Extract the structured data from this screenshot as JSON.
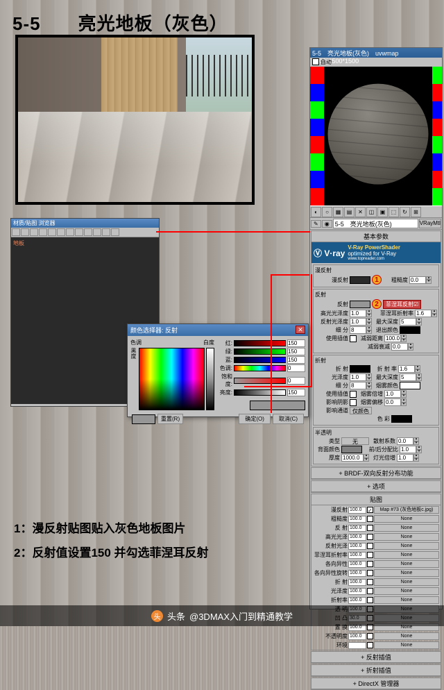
{
  "title": "5-5　　亮光地板（灰色）",
  "material_editor": {
    "window_title": "5-5　亮光地板(灰色)　uvwmap 1500*1500*1500",
    "auto": "自动",
    "name": "5-5　亮光地板(灰色)",
    "type": "VRayMtl",
    "rollout_basic": "基本参数",
    "vray_brand": "Ⓥ V·ray",
    "vray_shader": "V-Ray PowerShader",
    "vray_opt": "optimized for V-Ray",
    "vray_url": "www.topreader.com",
    "diffuse_section": "漫反射",
    "diffuse_label": "漫反射",
    "roughness_label": "粗糙度",
    "roughness_val": "0.0",
    "reflect_section": "反射",
    "reflect_label": "反射",
    "fresnel_label": "菲涅耳反射",
    "hilite_label": "高光光泽度",
    "fresnel_ior_label": "菲涅耳折射率",
    "fresnel_ior_val": "1.6",
    "refl_gloss_label": "反射光泽度",
    "refl_gloss_val": "1.0",
    "max_depth_label": "最大深度",
    "max_depth_val": "5",
    "subdivs_label": "细 分",
    "subdivs_val": "8",
    "exit_color_label": "退出颜色",
    "use_interp_label": "使用插值",
    "dim_distance_label": "减弱距离",
    "dim_distance_val": "100.0",
    "dim_falloff_label": "减弱衰减",
    "dim_falloff_val": "0.0",
    "refract_section": "折射",
    "refract_label": "折 射",
    "ior_label": "折 射 率",
    "ior_val": "1.6",
    "gloss_label": "光泽度",
    "gloss_val": "1.0",
    "fog_color_label": "烟雾颜色",
    "fog_mult_label": "烟雾倍增",
    "fog_mult_val": "1.0",
    "fog_bias_label": "烟雾偏移",
    "fog_bias_val": "0.0",
    "affect_shadows_label": "影响阴影",
    "affect_channels_label": "影响通道",
    "affect_channels_val": "仅颜色",
    "color_label": "色 彩",
    "translucency_section": "半透明",
    "type_label": "类型",
    "type_val": "无",
    "scatter_label": "散射系数",
    "scatter_val": "0.0",
    "back_color_label": "背面颜色",
    "fwd_back_label": "前/后分配比",
    "fwd_back_val": "1.0",
    "thickness_label": "厚度",
    "thickness_val": "1000.0",
    "light_mult_label": "灯光倍增",
    "light_mult_val": "1.0",
    "rollout_brdf": "BRDF-双向反射分布功能",
    "rollout_options": "选项",
    "rollout_maps": "贴图",
    "maps": [
      {
        "name": "漫反射",
        "amt": "100.0",
        "slot": "Map #73 (灰色地板c.jpg)",
        "chk": true
      },
      {
        "name": "粗糙度",
        "amt": "100.0",
        "slot": "None",
        "chk": false
      },
      {
        "name": "反 射",
        "amt": "100.0",
        "slot": "None",
        "chk": false
      },
      {
        "name": "高光光泽",
        "amt": "100.0",
        "slot": "None",
        "chk": false
      },
      {
        "name": "反射光泽",
        "amt": "100.0",
        "slot": "None",
        "chk": false
      },
      {
        "name": "菲涅耳折射率",
        "amt": "100.0",
        "slot": "None",
        "chk": false
      },
      {
        "name": "各向异性",
        "amt": "100.0",
        "slot": "None",
        "chk": false
      },
      {
        "name": "各向异性旋转",
        "amt": "100.0",
        "slot": "None",
        "chk": false
      },
      {
        "name": "折 射",
        "amt": "100.0",
        "slot": "None",
        "chk": false
      },
      {
        "name": "光泽度",
        "amt": "100.0",
        "slot": "None",
        "chk": false
      },
      {
        "name": "折射率",
        "amt": "100.0",
        "slot": "None",
        "chk": false
      },
      {
        "name": "透 明",
        "amt": "100.0",
        "slot": "None",
        "chk": false
      },
      {
        "name": "凹 凸",
        "amt": "30.0",
        "slot": "None",
        "chk": false
      },
      {
        "name": "置 换",
        "amt": "100.0",
        "slot": "None",
        "chk": false
      },
      {
        "name": "不透明度",
        "amt": "100.0",
        "slot": "None",
        "chk": false
      },
      {
        "name": "环境",
        "amt": "",
        "slot": "None",
        "chk": false
      }
    ],
    "rollout_reflect_interp": "反射插值",
    "rollout_refract_interp": "折射插值",
    "rollout_directx": "DirectX 管理器"
  },
  "browser": {
    "title": "材质/贴图 浏览器",
    "item": "地板"
  },
  "color_picker": {
    "title": "颜色选择器: 反射",
    "hue": "色调",
    "whiteness": "白度",
    "black": "黑度",
    "red": "红:",
    "green": "绿:",
    "blue": "蓝:",
    "hue_l": "色调:",
    "sat": "饱和度:",
    "val": "亮度:",
    "r": "150",
    "g": "150",
    "b": "150",
    "h": "0",
    "s": "0",
    "v": "150",
    "reset": "重置(R)",
    "ok": "确定(O)",
    "cancel": "取消(C)"
  },
  "instructions": {
    "line1": "1：漫反射贴图贴入灰色地板图片",
    "line2": "2：反射值设置150 并勾选菲涅耳反射"
  },
  "footer": {
    "label": "头条",
    "author": "@3DMAX入门到精通教学"
  },
  "markers": {
    "one": "1",
    "two": "2"
  }
}
